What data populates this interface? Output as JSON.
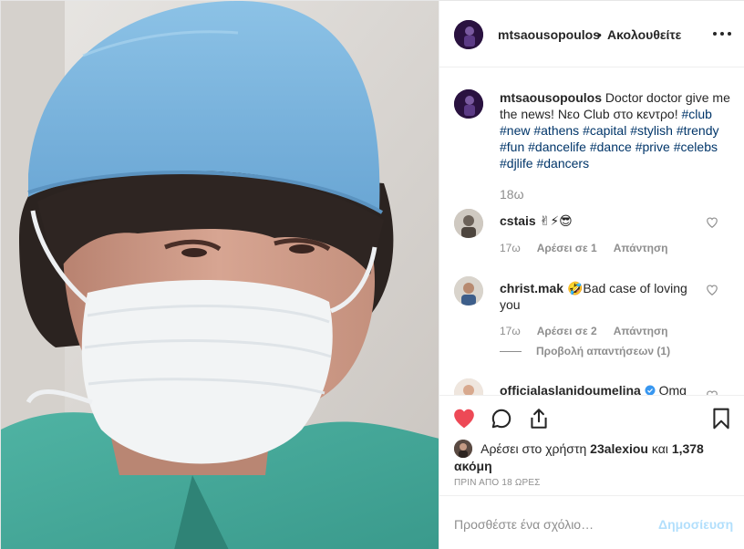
{
  "header": {
    "username": "mtsaousopoulos",
    "separator": "•",
    "follow_label": "Ακολουθείτε",
    "more_icon": "more-horizontal-icon"
  },
  "caption": {
    "username": "mtsaousopoulos",
    "text": "Doctor doctor give me the news! Νεο Club στο κεντρο!",
    "hashtags": [
      "#club",
      "#new",
      "#athens",
      "#capital",
      "#stylish",
      "#trendy",
      "#fun",
      "#dancelife",
      "#dance",
      "#prive",
      "#celebs",
      "#djlife",
      "#dancers"
    ],
    "time": "18ω"
  },
  "comments": [
    {
      "username": "cstais",
      "text": "✌⚡😎",
      "time": "17ω",
      "likes": "Αρέσει σε 1",
      "reply": "Απάντηση"
    },
    {
      "username": "christ.mak",
      "text": "🤣Bad case of loving you",
      "time": "17ω",
      "likes": "Αρέσει σε 2",
      "reply": "Απάντηση",
      "view_replies": "Προβολή απαντήσεων (1)"
    },
    {
      "username": "officialaslanidoumelina",
      "verified": true,
      "text": "Omg"
    }
  ],
  "actions": {
    "like_icon": "heart-filled-icon",
    "comment_icon": "comment-icon",
    "share_icon": "share-icon",
    "save_icon": "bookmark-icon",
    "liked": true,
    "like_color": "#ed4956"
  },
  "likes": {
    "prefix": "Αρέσει στο χρήστη",
    "user": "23alexiou",
    "and": "και",
    "others": "1,378 ακόμη"
  },
  "timestamp": "ΠΡΙΝ ΑΠΟ 18 ΩΡΕΣ",
  "add_comment": {
    "placeholder": "Προσθέστε ένα σχόλιο…",
    "post_label": "Δημοσίευση"
  },
  "colors": {
    "text": "#262626",
    "secondary": "#8e8e8e",
    "hashtag": "#003569",
    "post_disabled": "#b2dffc",
    "border": "#efefef"
  }
}
